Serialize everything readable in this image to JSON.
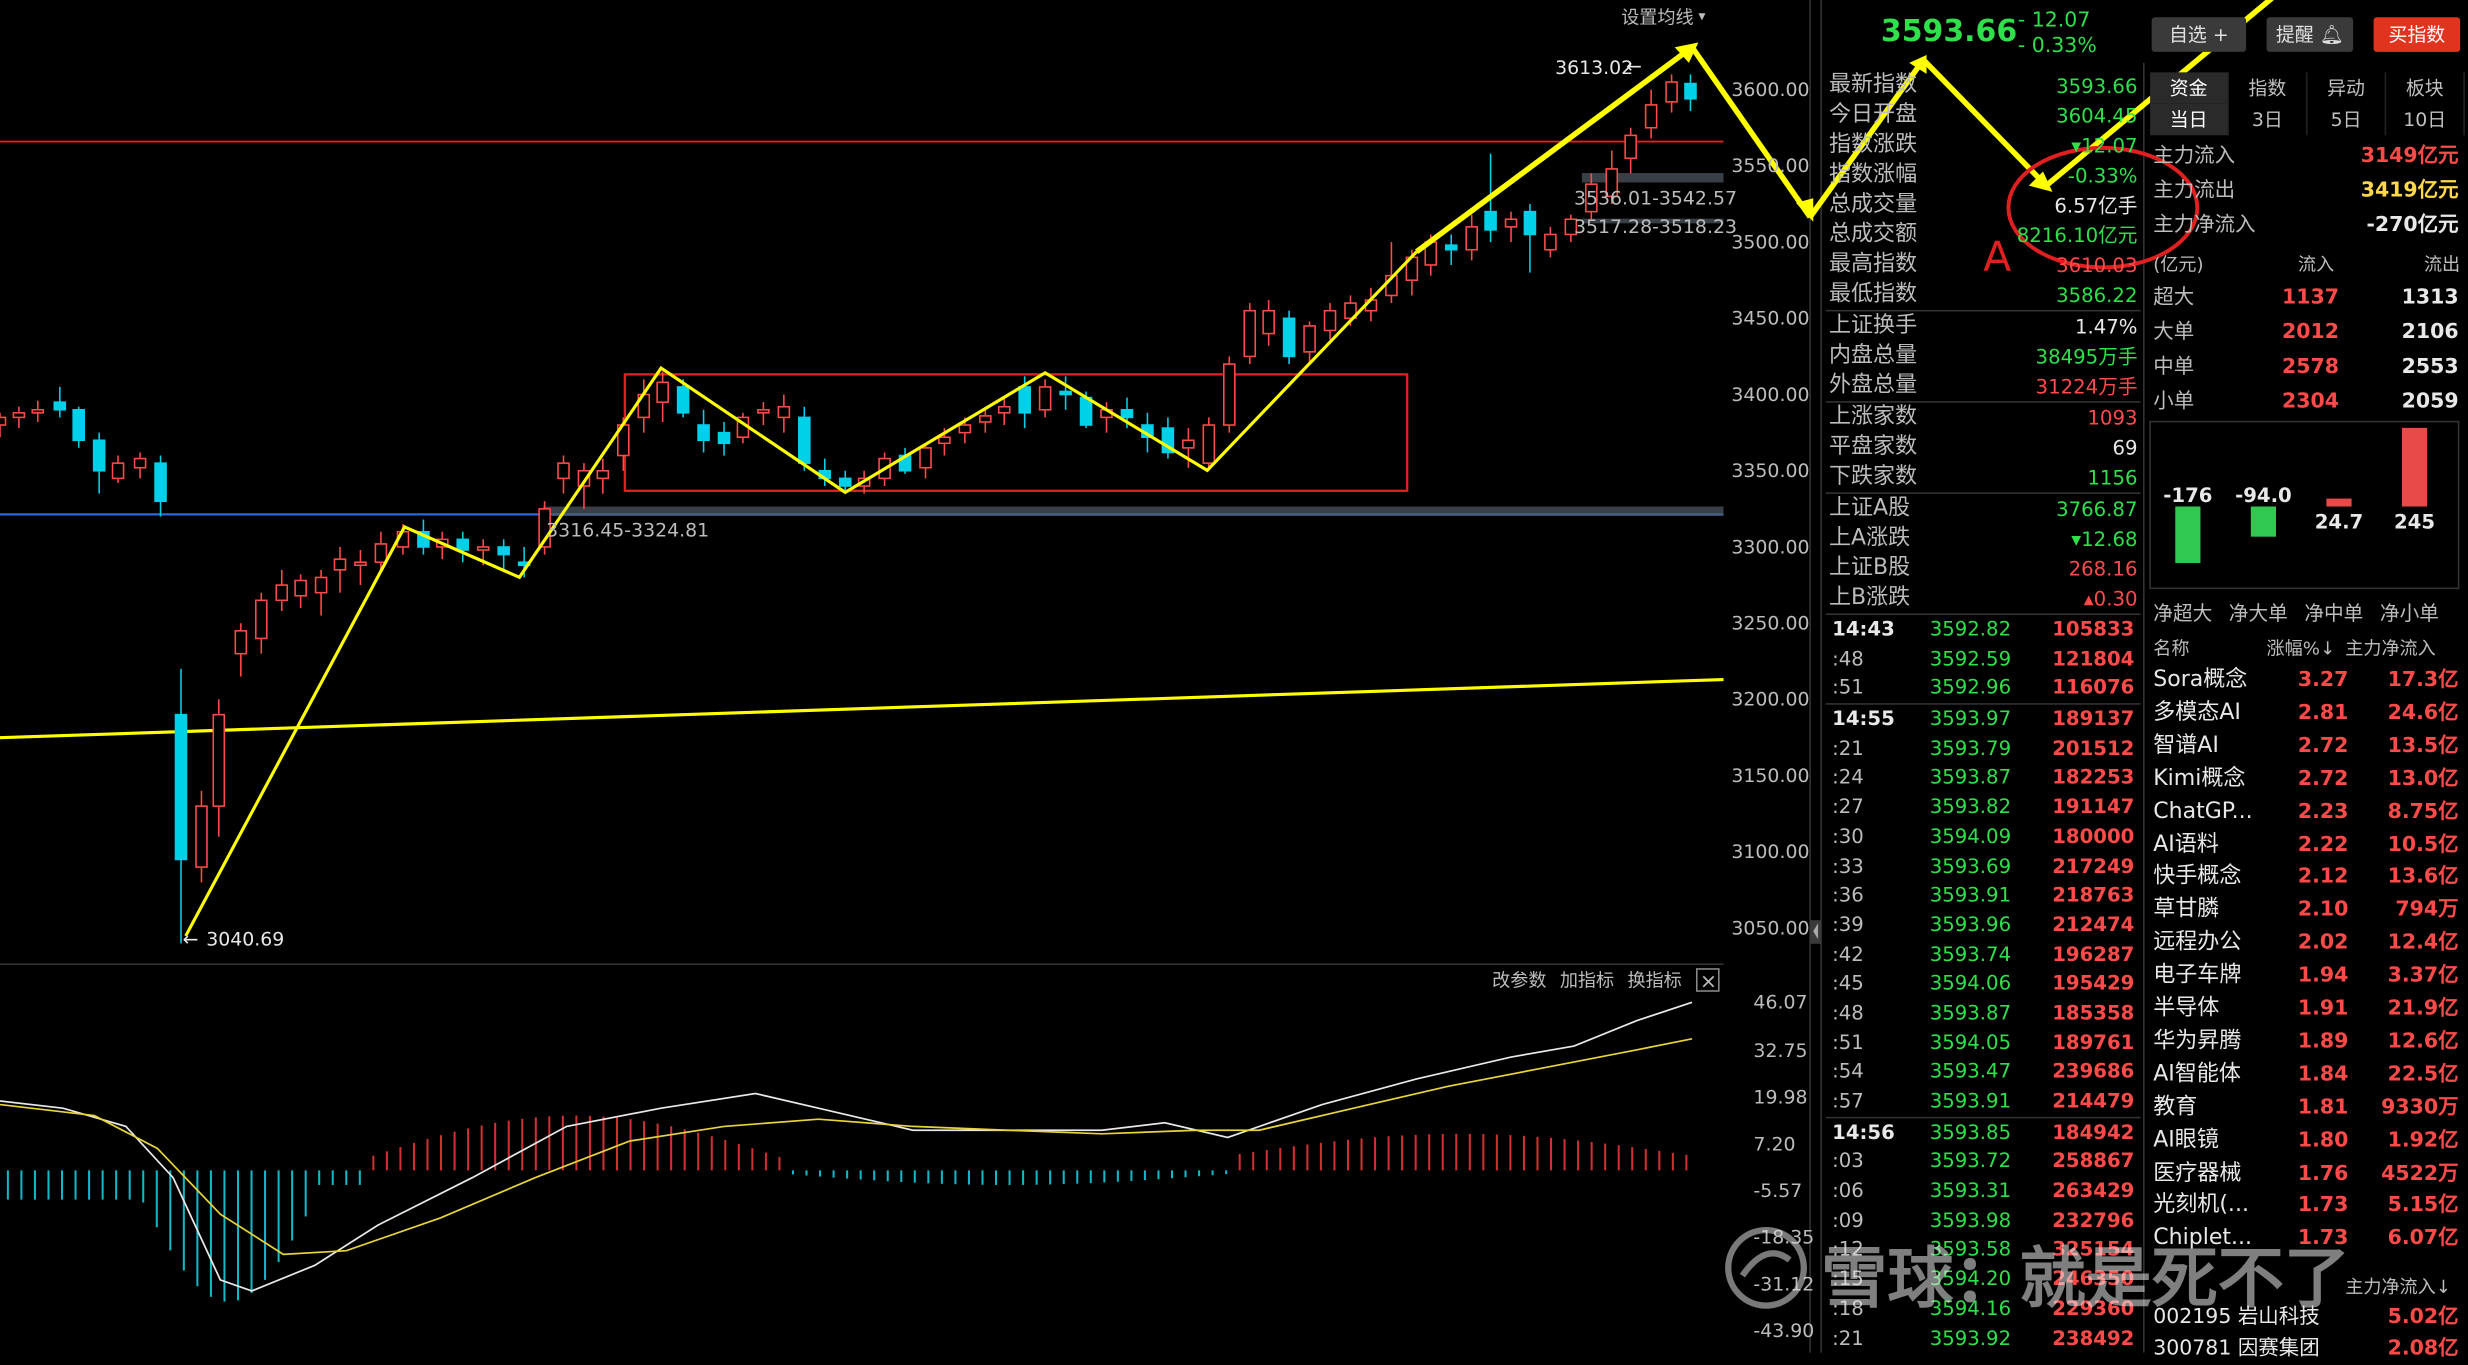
{
  "header": {
    "ma_settings_label": "设置均线",
    "price": "3593.66",
    "change": "- 12.07",
    "change_pct": "- 0.33%",
    "watchlist_btn": "自选",
    "alert_btn": "提醒",
    "buy_btn": "买指数"
  },
  "chart": {
    "y_axis_labels": [
      "3600.00",
      "3550.00",
      "3500.00",
      "3450.00",
      "3400.00",
      "3350.00",
      "3300.00",
      "3250.00",
      "3200.00",
      "3150.00",
      "3100.00",
      "3050.00"
    ],
    "high_marker": "3613.02",
    "low_marker": "3040.69",
    "gap1": "3536.01-3542.57",
    "gap2": "3517.28-3518.23",
    "gap3": "3316.45-3324.81",
    "annotation_a": "A"
  },
  "indicator": {
    "toolbar": [
      "改参数",
      "加指标",
      "换指标"
    ],
    "close_label": "×",
    "y_labels": [
      "46.07",
      "32.75",
      "19.98",
      "7.20",
      "-5.57",
      "-18.35",
      "-31.12",
      "-43.90"
    ]
  },
  "stats": [
    {
      "label": "最新指数",
      "value": "3593.66",
      "color": "#2ee04a"
    },
    {
      "label": "今日开盘",
      "value": "3604.45",
      "color": "#2ee04a"
    },
    {
      "label": "指数涨跌",
      "value": "▾12.07",
      "color": "#2ee04a"
    },
    {
      "label": "指数涨幅",
      "value": "-0.33%",
      "color": "#2ee04a"
    },
    {
      "label": "总成交量",
      "value": "6.57亿手",
      "color": "#e8e8e8"
    },
    {
      "label": "总成交额",
      "value": "8216.10亿元",
      "color": "#2ee04a"
    },
    {
      "label": "最高指数",
      "value": "3610.03",
      "color": "#ff4a4a"
    },
    {
      "label": "最低指数",
      "value": "3586.22",
      "color": "#2ee04a"
    },
    {
      "label": "上证换手",
      "value": "1.47%",
      "color": "#e8e8e8"
    },
    {
      "label": "内盘总量",
      "value": "38495万手",
      "color": "#2ee04a"
    },
    {
      "label": "外盘总量",
      "value": "31224万手",
      "color": "#ff4a4a"
    },
    {
      "label": "上涨家数",
      "value": "1093",
      "color": "#ff4a4a"
    },
    {
      "label": "平盘家数",
      "value": "69",
      "color": "#e8e8e8"
    },
    {
      "label": "下跌家数",
      "value": "1156",
      "color": "#2ee04a"
    },
    {
      "label": "上证A股",
      "value": "3766.87",
      "color": "#2ee04a"
    },
    {
      "label": "上A涨跌",
      "value": "▾12.68",
      "color": "#2ee04a"
    },
    {
      "label": "上证B股",
      "value": "268.16",
      "color": "#ff4a4a"
    },
    {
      "label": "上B涨跌",
      "value": "▴0.30",
      "color": "#ff4a4a"
    }
  ],
  "ticks": [
    {
      "t": "14:43",
      "p": "3592.82",
      "v": "105833"
    },
    {
      "t": ":48",
      "p": "3592.59",
      "v": "121804"
    },
    {
      "t": ":51",
      "p": "3592.96",
      "v": "116076"
    },
    {
      "t": "14:55",
      "p": "3593.97",
      "v": "189137"
    },
    {
      "t": ":21",
      "p": "3593.79",
      "v": "201512"
    },
    {
      "t": ":24",
      "p": "3593.87",
      "v": "182253"
    },
    {
      "t": ":27",
      "p": "3593.82",
      "v": "191147"
    },
    {
      "t": ":30",
      "p": "3594.09",
      "v": "180000"
    },
    {
      "t": ":33",
      "p": "3593.69",
      "v": "217249"
    },
    {
      "t": ":36",
      "p": "3593.91",
      "v": "218763"
    },
    {
      "t": ":39",
      "p": "3593.96",
      "v": "212474"
    },
    {
      "t": ":42",
      "p": "3593.74",
      "v": "196287"
    },
    {
      "t": ":45",
      "p": "3594.06",
      "v": "195429"
    },
    {
      "t": ":48",
      "p": "3593.87",
      "v": "185358"
    },
    {
      "t": ":51",
      "p": "3594.05",
      "v": "189761"
    },
    {
      "t": ":54",
      "p": "3593.47",
      "v": "239686"
    },
    {
      "t": ":57",
      "p": "3593.91",
      "v": "214479"
    },
    {
      "t": "14:56",
      "p": "3593.85",
      "v": "184942"
    },
    {
      "t": ":03",
      "p": "3593.72",
      "v": "258867"
    },
    {
      "t": ":06",
      "p": "3593.31",
      "v": "263429"
    },
    {
      "t": ":09",
      "p": "3593.98",
      "v": "232796"
    },
    {
      "t": ":12",
      "p": "3593.58",
      "v": "325154"
    },
    {
      "t": ":15",
      "p": "3594.20",
      "v": "246350"
    },
    {
      "t": ":18",
      "p": "3594.16",
      "v": "229360"
    },
    {
      "t": ":21",
      "p": "3593.92",
      "v": "238492"
    }
  ],
  "right": {
    "tabs1": [
      "资金",
      "指数",
      "异动",
      "板块"
    ],
    "tabs2": [
      "当日",
      "3日",
      "5日",
      "10日"
    ],
    "flows": [
      {
        "label": "主力流入",
        "value": "3149亿元",
        "color": "#ff4a4a"
      },
      {
        "label": "主力流出",
        "value": "3419亿元",
        "color": "#ffd84a"
      },
      {
        "label": "主力净流入",
        "value": "-270亿元",
        "color": "#e8e8e8"
      }
    ],
    "unit": "(亿元)",
    "in_label": "流入",
    "out_label": "流出",
    "sizes": [
      {
        "label": "超大",
        "in": "1137",
        "out": "1313"
      },
      {
        "label": "大单",
        "in": "2012",
        "out": "2106"
      },
      {
        "label": "中单",
        "in": "2578",
        "out": "2553"
      },
      {
        "label": "小单",
        "in": "2304",
        "out": "2059"
      }
    ],
    "net_values": [
      "-176",
      "-94.0",
      "24.7",
      "245"
    ],
    "net_labels": [
      "净超大",
      "净大单",
      "净中单",
      "净小单"
    ],
    "sector_header": {
      "name": "名称",
      "pct": "涨幅%↓",
      "flow": "主力净流入"
    },
    "sectors": [
      {
        "name": "Sora概念",
        "pct": "3.27",
        "flow": "17.3亿"
      },
      {
        "name": "多模态AI",
        "pct": "2.81",
        "flow": "24.6亿"
      },
      {
        "name": "智谱AI",
        "pct": "2.72",
        "flow": "13.5亿"
      },
      {
        "name": "Kimi概念",
        "pct": "2.72",
        "flow": "13.0亿"
      },
      {
        "name": "ChatGP...",
        "pct": "2.23",
        "flow": "8.75亿"
      },
      {
        "name": "AI语料",
        "pct": "2.22",
        "flow": "10.5亿"
      },
      {
        "name": "快手概念",
        "pct": "2.12",
        "flow": "13.6亿"
      },
      {
        "name": "草甘膦",
        "pct": "2.10",
        "flow": "794万"
      },
      {
        "name": "远程办公",
        "pct": "2.02",
        "flow": "12.4亿"
      },
      {
        "name": "电子车牌",
        "pct": "1.94",
        "flow": "3.37亿"
      },
      {
        "name": "半导体",
        "pct": "1.91",
        "flow": "21.9亿"
      },
      {
        "name": "华为昇腾",
        "pct": "1.89",
        "flow": "12.6亿"
      },
      {
        "name": "AI智能体",
        "pct": "1.84",
        "flow": "22.5亿"
      },
      {
        "name": "教育",
        "pct": "1.81",
        "flow": "9330万"
      },
      {
        "name": "AI眼镜",
        "pct": "1.80",
        "flow": "1.92亿"
      },
      {
        "name": "医疗器械",
        "pct": "1.76",
        "flow": "4522万"
      },
      {
        "name": "光刻机(...",
        "pct": "1.73",
        "flow": "5.15亿"
      },
      {
        "name": "Chiplet...",
        "pct": "1.73",
        "flow": "6.07亿"
      }
    ],
    "stock_header": {
      "flow": "主力净流入↓"
    },
    "stocks": [
      {
        "name": "002195 岩山科技",
        "flow": "5.02亿"
      },
      {
        "name": "300781 因赛集团",
        "flow": "2.08亿"
      }
    ]
  },
  "watermark": "雪球：就是死不了",
  "colors": {
    "up": "#ff4a4a",
    "down": "#00d0e8",
    "accent_yellow": "#ffff00",
    "green_text": "#2ee04a"
  }
}
